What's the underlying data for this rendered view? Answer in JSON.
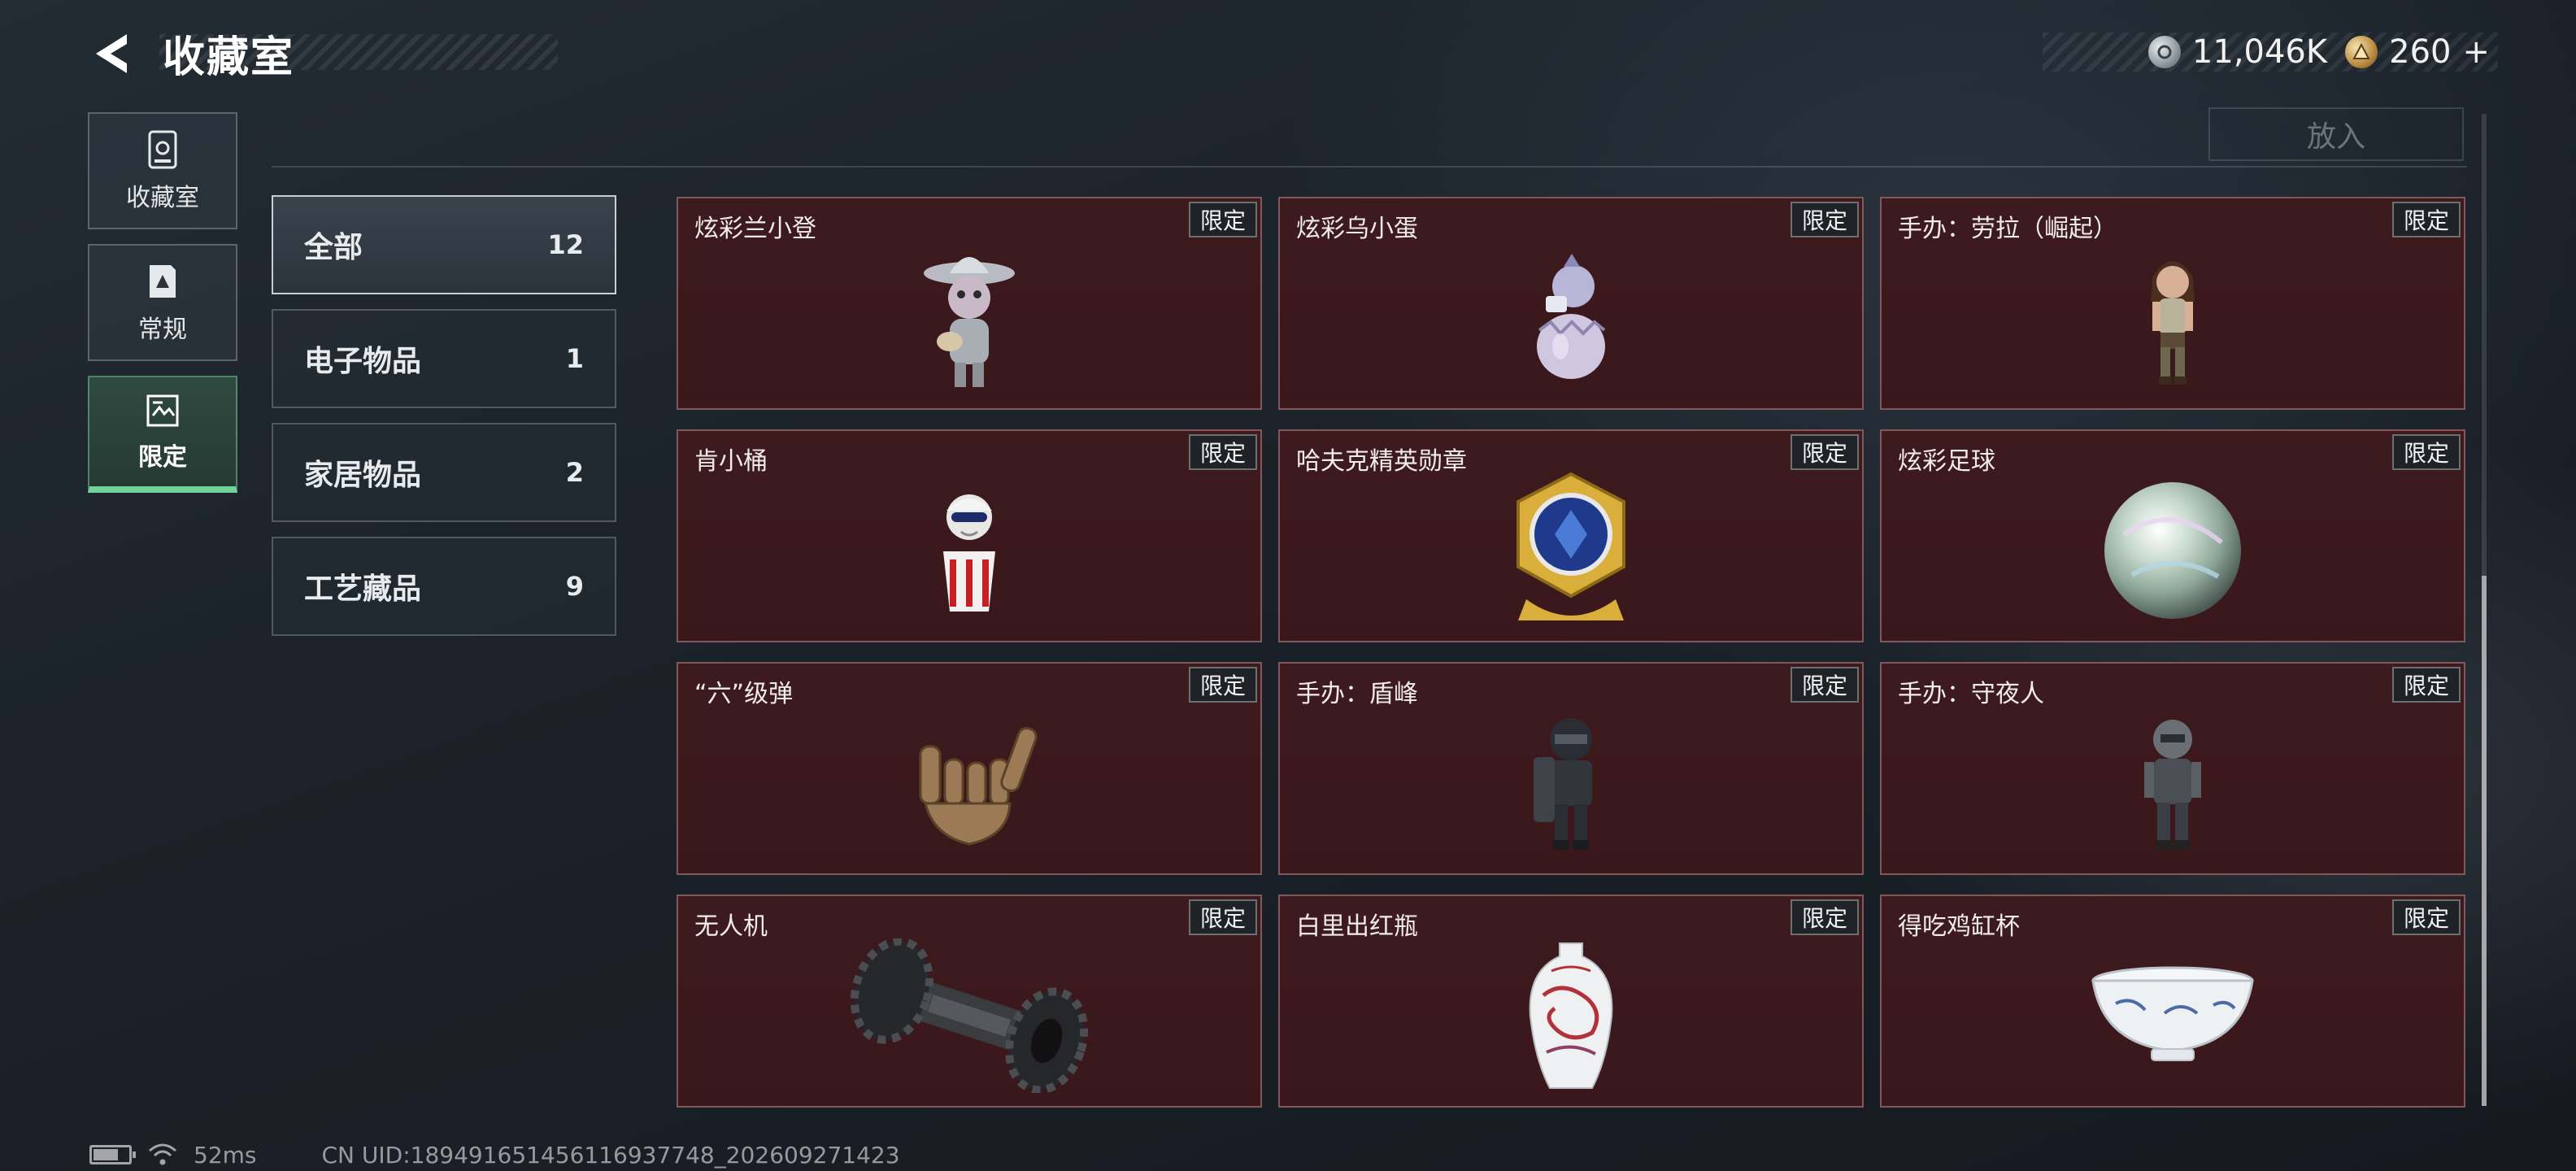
{
  "header": {
    "title": "收藏室",
    "currencies": [
      {
        "icon": "silver-coin-icon",
        "value": "11,046K"
      },
      {
        "icon": "gold-coin-icon",
        "value": "260"
      }
    ],
    "add_symbol": "+"
  },
  "leftnav": {
    "items": [
      {
        "label": "收藏室",
        "icon": "collection-room-icon",
        "active": false
      },
      {
        "label": "常规",
        "icon": "regular-icon",
        "active": false
      },
      {
        "label": "限定",
        "icon": "limited-icon",
        "active": true
      }
    ]
  },
  "toolbar": {
    "place_label": "放入"
  },
  "categories": [
    {
      "label": "全部",
      "count": "12",
      "active": true
    },
    {
      "label": "电子物品",
      "count": "1",
      "active": false
    },
    {
      "label": "家居物品",
      "count": "2",
      "active": false
    },
    {
      "label": "工艺藏品",
      "count": "9",
      "active": false
    }
  ],
  "cards": [
    {
      "name": "炫彩兰小登",
      "badge": "限定",
      "art": "mariachi-figure-icon"
    },
    {
      "name": "炫彩乌小蛋",
      "badge": "限定",
      "art": "egg-figure-icon"
    },
    {
      "name": "手办：劳拉（崛起）",
      "badge": "限定",
      "art": "lara-figure-icon"
    },
    {
      "name": "肯小桶",
      "badge": "限定",
      "art": "bucket-figure-icon"
    },
    {
      "name": "哈夫克精英勋章",
      "badge": "限定",
      "art": "elite-medal-icon"
    },
    {
      "name": "炫彩足球",
      "badge": "限定",
      "art": "iridescent-ball-icon"
    },
    {
      "name": "“六”级弹",
      "badge": "限定",
      "art": "bullet-hand-icon"
    },
    {
      "name": "手办：盾峰",
      "badge": "限定",
      "art": "shield-soldier-figure-icon"
    },
    {
      "name": "手办：守夜人",
      "badge": "限定",
      "art": "night-watch-figure-icon"
    },
    {
      "name": "无人机",
      "badge": "限定",
      "art": "drone-wheel-icon"
    },
    {
      "name": "白里出红瓶",
      "badge": "限定",
      "art": "porcelain-vase-icon"
    },
    {
      "name": "得吃鸡缸杯",
      "badge": "限定",
      "art": "porcelain-cup-icon"
    }
  ],
  "status": {
    "latency": "52ms",
    "uid": "CN UID:1894916514561169377​48_202609271423"
  }
}
